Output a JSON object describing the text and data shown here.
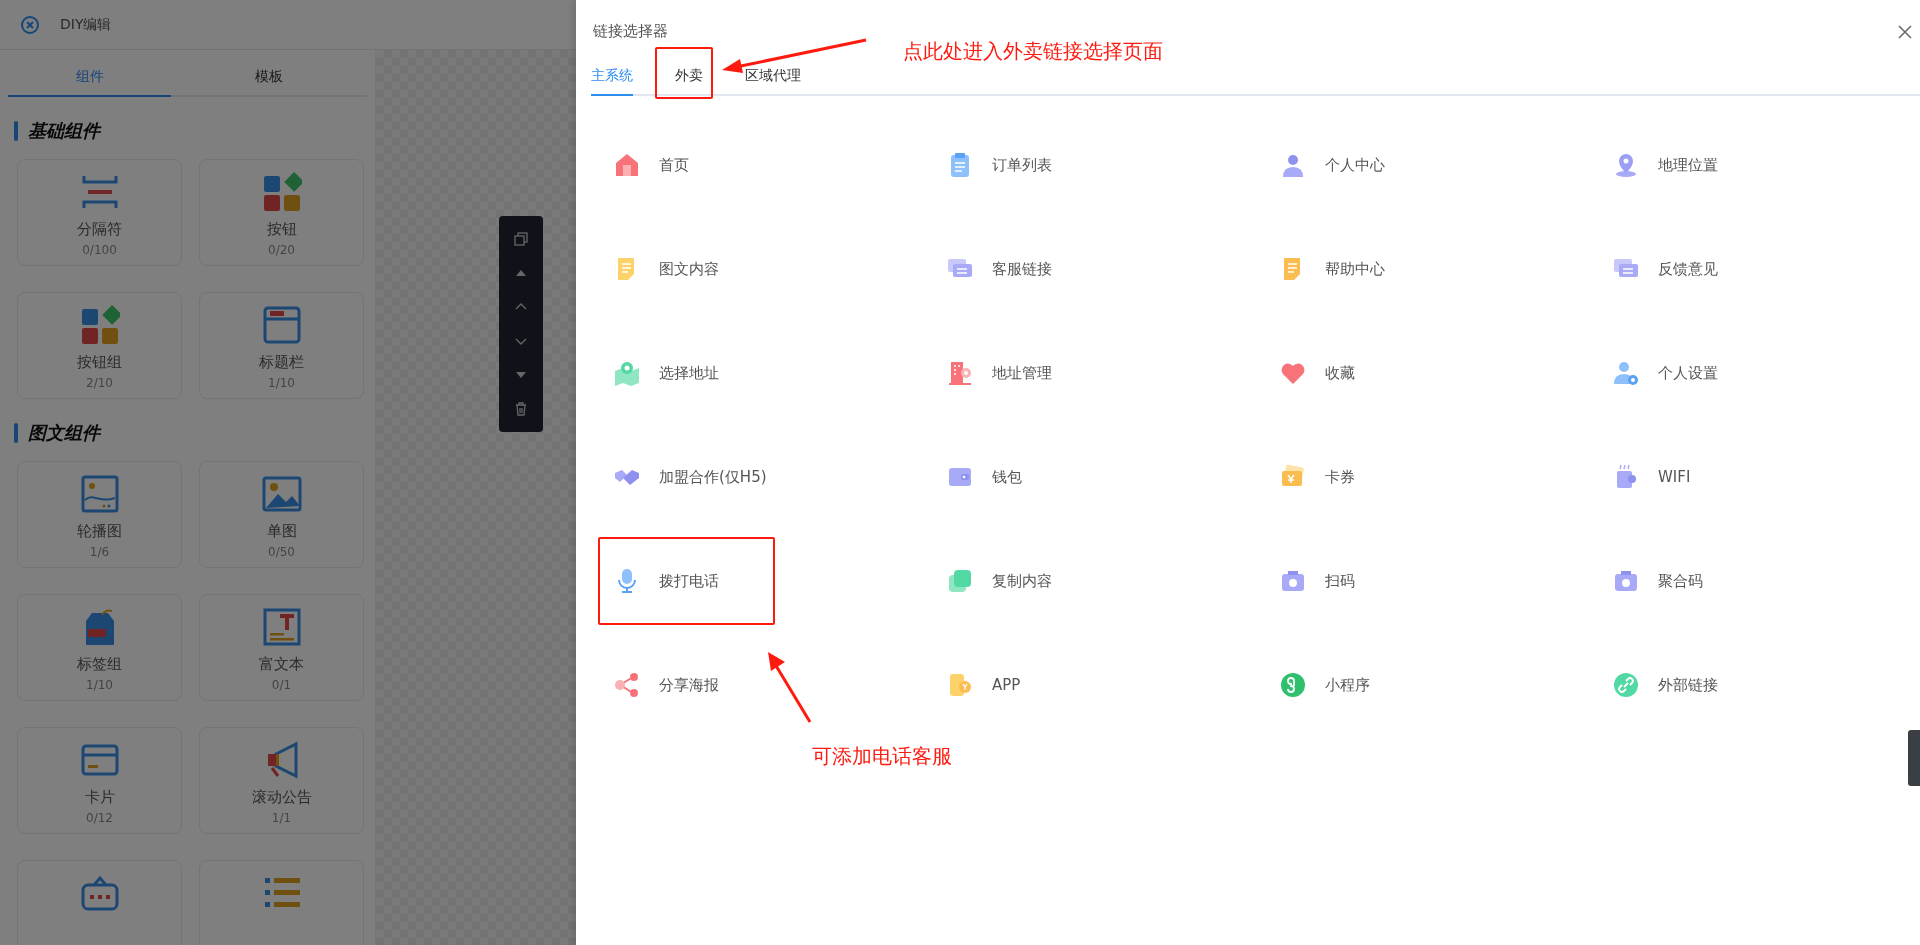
{
  "editor": {
    "title": "DIY编辑",
    "tabs": [
      {
        "label": "组件",
        "selected": true
      },
      {
        "label": "模板",
        "selected": false
      }
    ],
    "sections": [
      {
        "title": "基础组件",
        "components": [
          {
            "kind": "card",
            "name": "分隔符",
            "count": "0/100"
          },
          {
            "kind": "card",
            "name": "按钮",
            "count": "0/20"
          },
          {
            "kind": "card",
            "name": "按钮组",
            "count": "2/10"
          },
          {
            "kind": "card",
            "name": "标题栏",
            "count": "1/10"
          }
        ]
      },
      {
        "title": "图文组件",
        "components": [
          {
            "kind": "card",
            "name": "轮播图",
            "count": "1/6"
          },
          {
            "kind": "card",
            "name": "单图",
            "count": "0/50"
          },
          {
            "kind": "card",
            "name": "标签组",
            "count": "1/10"
          },
          {
            "kind": "card",
            "name": "富文本",
            "count": "0/1"
          },
          {
            "kind": "card",
            "name": "卡片",
            "count": "0/12"
          },
          {
            "kind": "card",
            "name": "滚动公告",
            "count": "1/1"
          },
          {
            "kind": "icon_only"
          },
          {
            "kind": "icon_only"
          }
        ]
      }
    ]
  },
  "drawer": {
    "title": "链接选择器",
    "tabs": [
      {
        "label": "主系统",
        "selected": true,
        "highlighted": false
      },
      {
        "label": "外卖",
        "selected": false,
        "highlighted": true
      },
      {
        "label": "区域代理",
        "selected": false,
        "highlighted": false
      }
    ],
    "links": [
      {
        "label": "首页",
        "highlighted": false
      },
      {
        "label": "订单列表",
        "highlighted": false
      },
      {
        "label": "个人中心",
        "highlighted": false
      },
      {
        "label": "地理位置",
        "highlighted": false
      },
      {
        "label": "图文内容",
        "highlighted": false
      },
      {
        "label": "客服链接",
        "highlighted": false
      },
      {
        "label": "帮助中心",
        "highlighted": false
      },
      {
        "label": "反馈意见",
        "highlighted": false
      },
      {
        "label": "选择地址",
        "highlighted": false
      },
      {
        "label": "地址管理",
        "highlighted": false
      },
      {
        "label": "收藏",
        "highlighted": false
      },
      {
        "label": "个人设置",
        "highlighted": false
      },
      {
        "label": "加盟合作(仅H5)",
        "highlighted": false
      },
      {
        "label": "钱包",
        "highlighted": false
      },
      {
        "label": "卡券",
        "highlighted": false
      },
      {
        "label": "WIFI",
        "highlighted": false
      },
      {
        "label": "拨打电话",
        "highlighted": true
      },
      {
        "label": "复制内容",
        "highlighted": false
      },
      {
        "label": "扫码",
        "highlighted": false
      },
      {
        "label": "聚合码",
        "highlighted": false
      },
      {
        "label": "分享海报",
        "highlighted": false
      },
      {
        "label": "APP",
        "highlighted": false
      },
      {
        "label": "小程序",
        "highlighted": false
      },
      {
        "label": "外部链接",
        "highlighted": false
      }
    ]
  },
  "annotations": [
    {
      "text": "点此处进入外卖链接选择页面"
    },
    {
      "text": "可添加电话客服"
    }
  ]
}
